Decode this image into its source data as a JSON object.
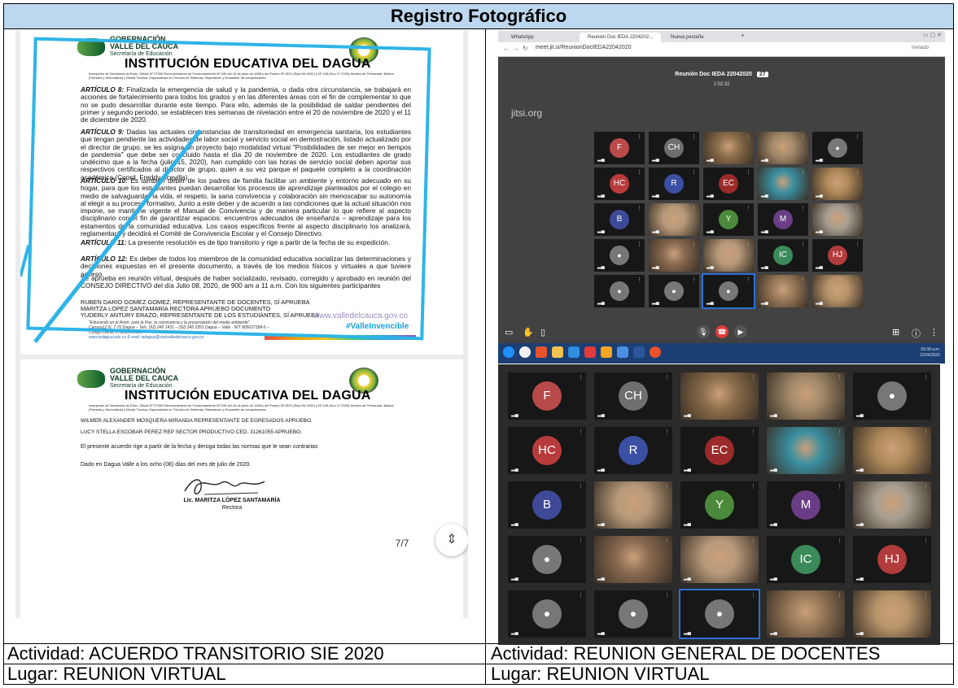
{
  "header": {
    "title": "Registro Fotográfico"
  },
  "document": {
    "gov_line1": "GOBERNACIÓN",
    "gov_line2": "VALLE DEL CAUCA",
    "gov_line3": "Secretaría de Educación",
    "institution": "INSTITUCIÓN EDUCATIVA DEL DAGUA",
    "fine_print": "Inscripción de Secretaría de Educ. Oficial Nº 07350 Reconocimiento de Funcionamiento Nº 049 del 16 de junio de 1998 y del Fusión Nº 0874 (Sept 06 2002) y Nº 108 (Nov 17 2003) Niveles de Preescolar, Básica (Primaria y Secundaria) y Media Técnica, Especialidad en Técnica en Sistemas, Reparación y Ensamble de computadores.",
    "art8_title": "ARTÍCULO 8:",
    "art8_text": "Finalizada la emergencia de salud y la pandemia, o dada otra circunstancia, se trabajará en acciones de fortalecimiento para todos los grados y en las diferentes áreas con el fin de complementar lo que no se pudo desarrollar durante este tiempo. Para ello, además de la posibilidad de saldar pendientes del primer y segundo periodo, se establecen tres semanas de nivelación entre el 20 de noviembre de 2020 y el 11 de diciembre de 2020.",
    "art9_title": "ARTÍCULO 9:",
    "art9_text": "Dadas las actuales circunstancias de transitoriedad en emergencia sanitaria, los estudiantes que tengan pendiente las actividades de labor social y servicio social en demostración, listado actualizado por el director de grupo, se les asigna un proyecto bajo modalidad virtual \"Posibilidades de ser mejor en tiempos de pandemia\" que debe ser concluido hasta el día 20 de noviembre de 2020. Los estudiantes de grado undécimo que a la fecha (julio 15, 2020), han cumplido con las horas de servicio social deben aportar sus respectivos certificados al director de grupo, quien a su vez parque el paquete completo a la coordinación académica (Coord. Freddy Acevilla).",
    "art10_title": "ARTÍCULO 10:",
    "art10_text": "Es también deber de los padres de familia facilitar un ambiente y entorno adecuado en su hogar, para que los estudiantes puedan desarrollar los procesos de aprendizaje planteados por el colegio en medio de salvaguardar la vida, el respeto, la sana convivencia y colaboración sin menoscabar su autonomía al elegir a su proceso formativo. Junto a este deber y de acuerdo a las condiciones que la actual situación nos impone, se mantiene vigente el Manual de Convivencia y de manera particular lo que refiere al aspecto disciplinario con el fin de garantizar espacios: encuentros adecuados de enseñanza – aprendizaje para los estamentos de la comunidad educativa. Los casos específicos frente al aspecto disciplinario los analizará, reglamentará y decidirá el Comité de Convivencia Escolar y el Consejo Directivo.",
    "art11_title": "ARTÍCULO 11:",
    "art11_text": "La presente resolución es de tipo transitorio y rige a partir de la fecha de su expedición.",
    "art12_title": "ARTÍCULO 12:",
    "art12_text": "Es deber de todos los miembros de la comunidad educativa socializar las determinaciones y decisiones expuestas en el presente documento, a través de los medios físicos y virtuales a que tuviere acceso.",
    "approval": "Se aprueba en reunión virtual, después de haber socializado, revisado, corregido y aprobado en reunión del CONSEJO DIRECTIVO del día Julio 08, 2020, de 900 am a 11 a.m. Con los siguientes participantes",
    "part1": "RUBEN DARIO GOMEZ GOMEZ, REPRESENTANTE DE DOCENTES, SÍ APRUEBA",
    "part2": "MARITZA LOPEZ SANTAMARIA RECTORA APRUEBO DOCUMENTO",
    "part3": "YUDERLY ANTURY ERAZO, REPRESENTANTE DE LOS ESTUDIANTES, SÍ APRUEBA",
    "slogan": "\"Educando en el Amor, para la Paz, la convivencia y la preservación del medio ambiente\"",
    "address": "Carrera12 N. 7-70 Dagua – Tels. (92) 245 1431 – (92) 245 3351 Dagua – Valle · NIT 805027398-5 – Código DANE 176233000016",
    "email": "www.iedagua.edu.co  E-mail: iedagua@sedvalledelcauca.gov.co",
    "web": "www.valledelcauca.gov.co",
    "hashtag": "#ValleInvencible",
    "p2_line1": "WILMER ALEXANDER MOSQUERA MIRANDA REPRESENTANTE DE EGRESADOS APRUEBO.",
    "p2_line2": "LUCY STELLA ESCOBAR PEREZ REP SECTOR PRODUCTIVO CED. 31261055 APRUEBO.",
    "p2_line3": "El presente acuerdo rige a partir de la fecha y deroga todas las normas que le sean contrarias",
    "p2_line4": "Dado en Dagua Valle a los ocho (08) días del mes de julio de 2020.",
    "signer": "Lic. MARITZA LÓPEZ SANTAMARÍA",
    "signer_role": "Rectora",
    "page_indicator": "7/7"
  },
  "browser": {
    "tab1": "WhatsApp",
    "tab2": "Reunión Doc IEDA 2204202...",
    "tab3": "Nueva pestaña",
    "url": "meet.jit.si/ReunionDocIEDA22042020",
    "profile": "Invitado",
    "meeting_title": "Reunión Doc IEDA 22042020",
    "participant_count": "27",
    "elapsed": "1:02:32",
    "logo": "jitsi.org",
    "clock_time": "09:38 a.m.",
    "clock_date": "22/04/2020"
  },
  "tiles": [
    {
      "initials": "F",
      "color": "#b84a4a"
    },
    {
      "initials": "CH",
      "color": "#6f6f6f"
    },
    {
      "initials": "",
      "color": "#8c6e4a"
    },
    {
      "initials": "",
      "color": "#a38a6a"
    },
    {
      "initials": "",
      "color": "#808080"
    },
    {
      "initials": "HC",
      "color": "#b83b3b"
    },
    {
      "initials": "R",
      "color": "#3b4fa3"
    },
    {
      "initials": "EC",
      "color": "#9b2b2b"
    },
    {
      "initials": "",
      "color": "#3a8fa0"
    },
    {
      "initials": "",
      "color": "#b08a5a"
    },
    {
      "initials": "B",
      "color": "#3e4a98"
    },
    {
      "initials": "",
      "color": "#b89a7a"
    },
    {
      "initials": "Y",
      "color": "#4b8a3a"
    },
    {
      "initials": "M",
      "color": "#6a3e86"
    },
    {
      "initials": "",
      "color": "#a89f92"
    },
    {
      "initials": "",
      "color": "#808080"
    },
    {
      "initials": "",
      "color": "#8a6a50"
    },
    {
      "initials": "",
      "color": "#b89a7a"
    },
    {
      "initials": "IC",
      "color": "#3b8a5a"
    },
    {
      "initials": "HJ",
      "color": "#b23b3b"
    },
    {
      "initials": "",
      "color": "#808080"
    },
    {
      "initials": "",
      "color": "#808080"
    },
    {
      "initials": "",
      "color": "#808080"
    },
    {
      "initials": "",
      "color": "#9a7a5a"
    },
    {
      "initials": "",
      "color": "#b8946a"
    }
  ],
  "captions": {
    "left_activity": "Actividad: ACUERDO TRANSITORIO SIE 2020",
    "left_place": "Lugar: REUNION VIRTUAL",
    "right_activity": "Actividad: REUNION GENERAL DE DOCENTES",
    "right_place": "Lugar: REUNION VIRTUAL"
  }
}
